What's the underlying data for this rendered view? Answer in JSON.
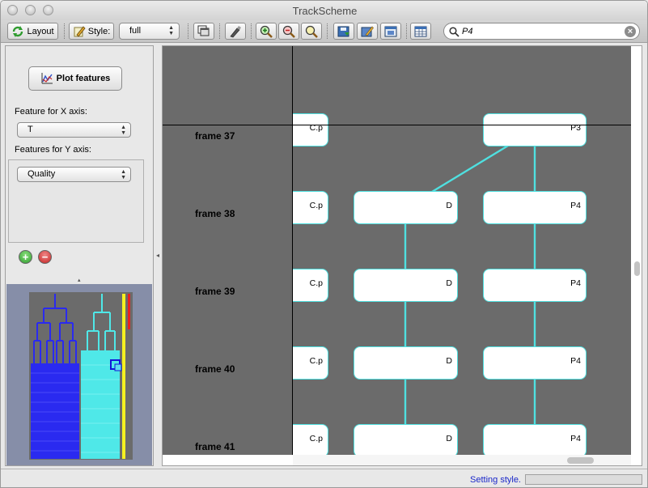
{
  "window": {
    "title": "TrackScheme"
  },
  "toolbar": {
    "layout_label": "Layout",
    "style_label": "Style:",
    "style_value": "full",
    "search_value": "P4"
  },
  "left_panel": {
    "plot_button_label": "Plot features",
    "x_axis_label": "Feature for X axis:",
    "x_axis_value": "T",
    "y_axis_label": "Features for Y axis:",
    "y_axis_value": "Quality",
    "add_symbol": "+",
    "remove_symbol": "−"
  },
  "graph": {
    "frames": [
      {
        "label": "frame 37"
      },
      {
        "label": "frame 38"
      },
      {
        "label": "frame 39"
      },
      {
        "label": "frame 40"
      },
      {
        "label": "frame 41"
      }
    ],
    "nodes": {
      "c_37": "C.p",
      "p_37": "P3",
      "c_38": "C.p",
      "d_38": "D",
      "p_38": "P4",
      "c_39": "C.p",
      "d_39": "D",
      "p_39": "P4",
      "c_40": "C.p",
      "d_40": "D",
      "p_40": "P4",
      "c_41": "C.p",
      "d_41": "D",
      "p_41": "P4"
    },
    "colors": {
      "background": "#6b6b6b",
      "edge": "#4fe0e0",
      "node_border": "#4fe0e0"
    }
  },
  "status": {
    "text": "Setting style."
  }
}
